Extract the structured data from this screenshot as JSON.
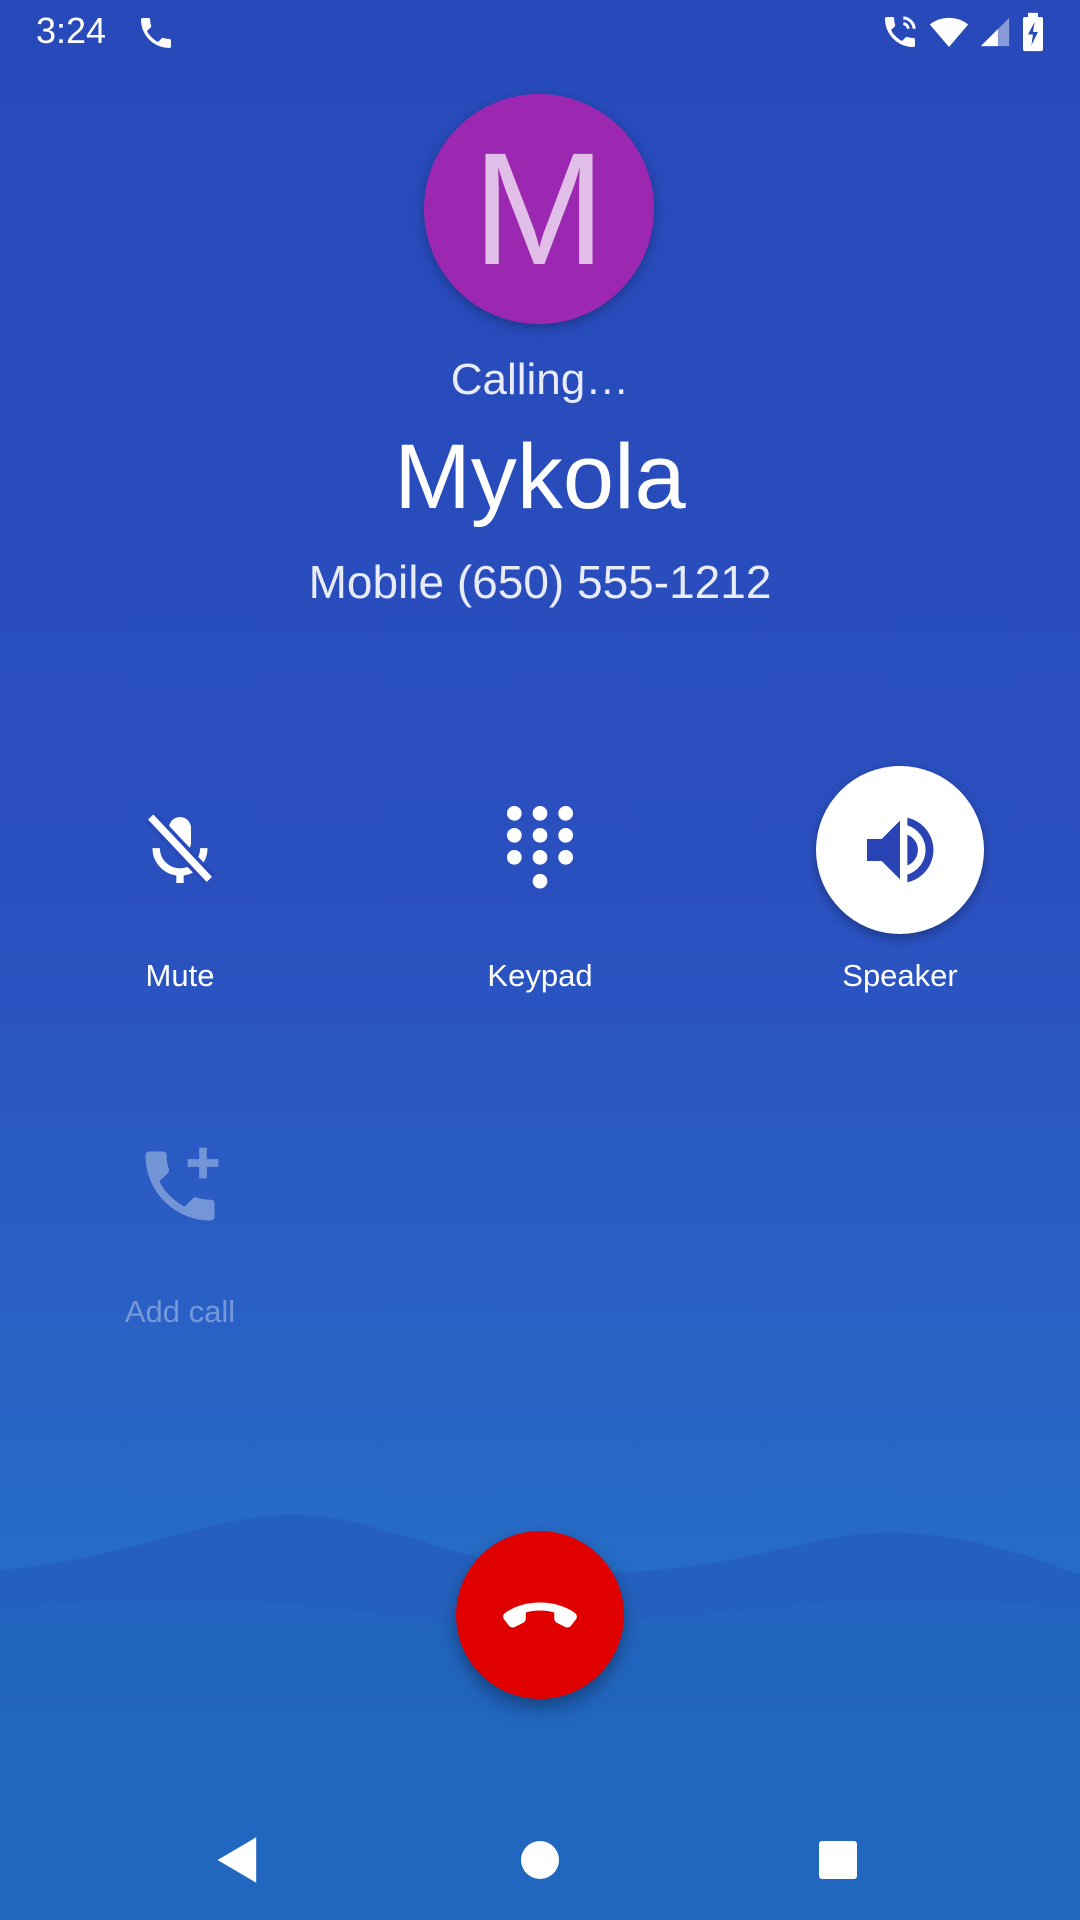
{
  "status_bar": {
    "time": "3:24",
    "icons": [
      "phone-icon",
      "wifi-calling-icon",
      "wifi-icon",
      "signal-icon",
      "battery-charging-icon"
    ]
  },
  "contact": {
    "avatar_letter": "M",
    "avatar_color": "#9c27b0",
    "call_status": "Calling…",
    "name": "Mykola",
    "number": "Mobile (650) 555-1212"
  },
  "controls": {
    "mute": {
      "label": "Mute",
      "icon": "mic-off-icon"
    },
    "keypad": {
      "label": "Keypad",
      "icon": "dialpad-icon"
    },
    "speaker": {
      "label": "Speaker",
      "icon": "speaker-icon",
      "active": true
    },
    "add_call": {
      "label": "Add call",
      "icon": "add-call-icon",
      "enabled": false
    }
  },
  "end_call": {
    "icon": "call-end-icon",
    "color": "#e00000"
  },
  "nav": {
    "icons": [
      "back-icon",
      "home-icon",
      "recents-icon"
    ]
  }
}
